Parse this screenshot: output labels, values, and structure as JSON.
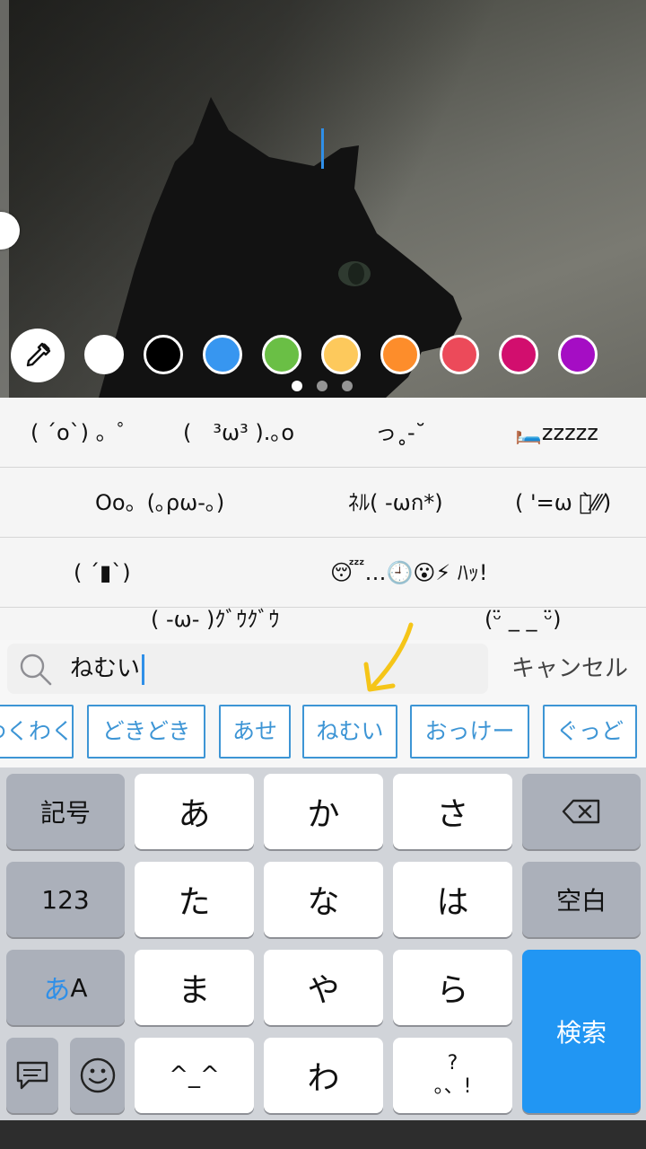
{
  "photo": {
    "colors": [
      "#ffffff",
      "#000000",
      "#3796f0",
      "#6abf45",
      "#fdc95c",
      "#fd8d2b",
      "#ec4a5a",
      "#d20e6e",
      "#a50dc4"
    ],
    "page_count": 3,
    "active_page": 0
  },
  "kaomoji": [
    [
      "( ´o`) 。゜",
      "(　³ω³ ).｡o",
      "っ˳-˘",
      "🛏️zzzzz"
    ],
    [
      "Oo。(｡ρω-｡)",
      "ﾈﾙ( -ωก*)",
      "( '=ω ก̀⁄⁄⁄)"
    ],
    [
      "( ´▮`)",
      "😴…🕘😮⚡ ﾊｯ!"
    ],
    [
      "( -ω- )ｸﾞｳｸﾞｳ",
      "(ᵕ̈ _ _ ᵕ̈)"
    ]
  ],
  "search": {
    "value": "ねむい",
    "cancel_label": "キャンセル"
  },
  "chips": [
    "わくわく",
    "どきどき",
    "あせ",
    "ねむい",
    "おっけー",
    "ぐっど"
  ],
  "keyboard": {
    "symbols_label": "記号",
    "numbers_label": "123",
    "kana_label_a": "あ",
    "kana_label_A": "A",
    "space_label": "空白",
    "search_label": "検索",
    "rows": [
      [
        "あ",
        "か",
        "さ"
      ],
      [
        "た",
        "な",
        "は"
      ],
      [
        "ま",
        "や",
        "ら"
      ],
      [
        "^_^",
        "わ",
        "?。、!"
      ]
    ],
    "punct_top": "?",
    "punct_bottom": "。、!"
  }
}
